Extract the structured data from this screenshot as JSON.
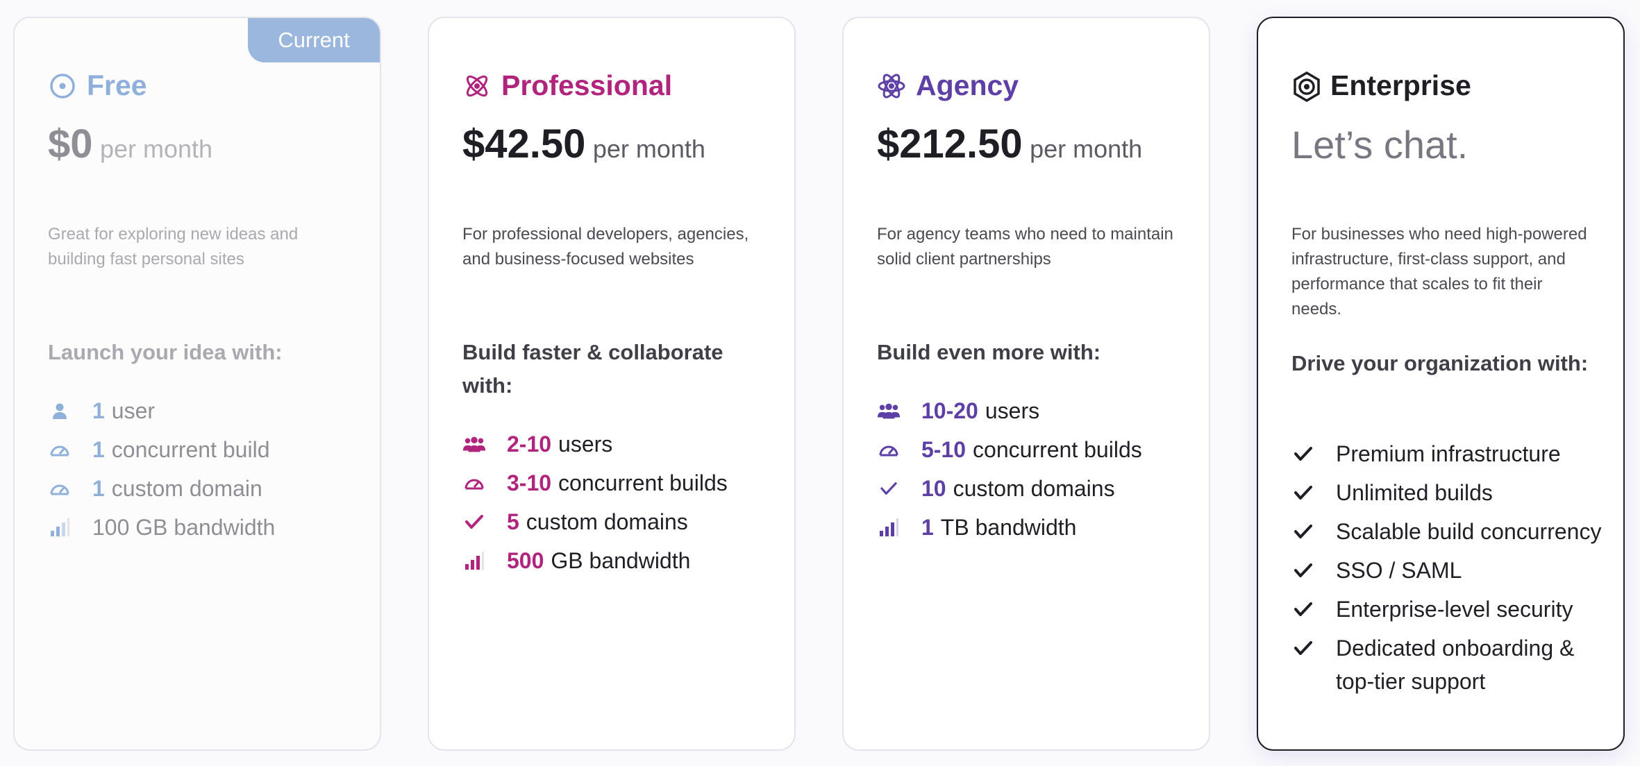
{
  "plans": {
    "free": {
      "badge": "Current",
      "name": "Free",
      "price": "$0",
      "period": "per month",
      "description": "Great for exploring new ideas and building fast personal sites",
      "subhead": "Launch your idea with:",
      "features": [
        {
          "bold": "1",
          "text": "user",
          "icon": "user-icon"
        },
        {
          "bold": "1",
          "text": "concurrent build",
          "icon": "speedometer-icon"
        },
        {
          "bold": "1",
          "text": "custom domain",
          "icon": "speedometer-icon"
        },
        {
          "bold": "",
          "text": "100 GB bandwidth",
          "icon": "signal-bars-icon"
        }
      ],
      "accent": "#8fb0da"
    },
    "professional": {
      "name": "Professional",
      "price": "$42.50",
      "period": "per month",
      "description": "For professional developers, agencies, and business-focused websites",
      "subhead": "Build faster & collaborate with:",
      "features": [
        {
          "bold": "2-10",
          "text": "users",
          "icon": "users-icon"
        },
        {
          "bold": "3-10",
          "text": "concurrent builds",
          "icon": "speedometer-icon"
        },
        {
          "bold": "5",
          "text": "custom domains",
          "icon": "check-icon"
        },
        {
          "bold": "500",
          "text": "GB bandwidth",
          "icon": "signal-bars-icon"
        }
      ],
      "accent": "#b0247e"
    },
    "agency": {
      "name": "Agency",
      "price": "$212.50",
      "period": "per month",
      "description": "For agency teams who need to maintain solid client partnerships",
      "subhead": "Build even more with:",
      "features": [
        {
          "bold": "10-20",
          "text": "users",
          "icon": "users-icon"
        },
        {
          "bold": "5-10",
          "text": "concurrent builds",
          "icon": "speedometer-icon"
        },
        {
          "bold": "10",
          "text": "custom domains",
          "icon": "check-icon"
        },
        {
          "bold": "1",
          "text": "TB bandwidth",
          "icon": "signal-bars-icon"
        }
      ],
      "accent": "#5d3fa6"
    },
    "enterprise": {
      "name": "Enterprise",
      "price_text": "Let’s chat.",
      "description": "For businesses who need high-powered infrastructure, first-class support, and performance that scales to fit their needs.",
      "subhead": "Drive your organization with:",
      "features": [
        {
          "text": "Premium infrastructure",
          "icon": "check-icon"
        },
        {
          "text": "Unlimited builds",
          "icon": "check-icon"
        },
        {
          "text": "Scalable build concurrency",
          "icon": "check-icon"
        },
        {
          "text": "SSO / SAML",
          "icon": "check-icon"
        },
        {
          "text": "Enterprise-level security",
          "icon": "check-icon"
        },
        {
          "text": "Dedicated onboarding & top-tier support",
          "icon": "check-icon"
        }
      ],
      "accent": "#1e1e24"
    }
  }
}
